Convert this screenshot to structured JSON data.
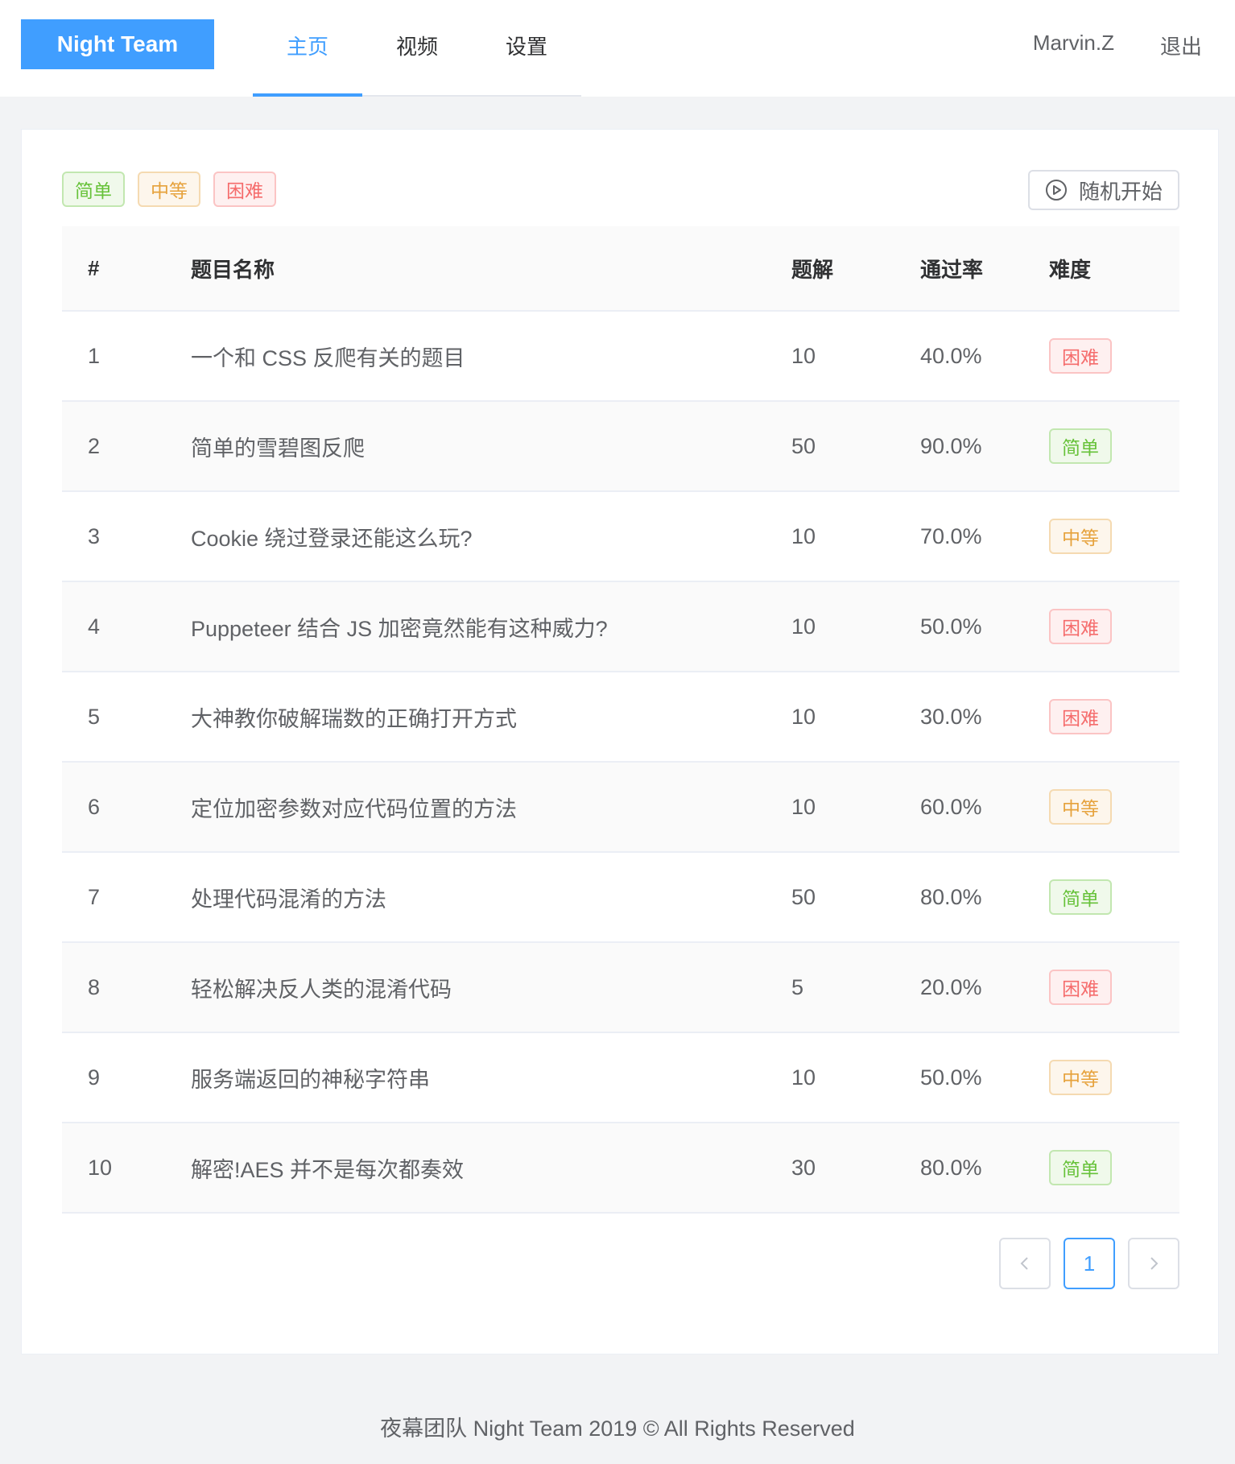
{
  "header": {
    "logo": "Night Team",
    "nav": [
      "主页",
      "视频",
      "设置"
    ],
    "user": "Marvin.Z",
    "logout": "退出"
  },
  "filters": {
    "easy": "简单",
    "medium": "中等",
    "hard": "困难",
    "random_button": "随机开始"
  },
  "table": {
    "headers": [
      "#",
      "题目名称",
      "题解",
      "通过率",
      "难度"
    ],
    "rows": [
      {
        "num": "1",
        "name": "一个和 CSS 反爬有关的题目",
        "solutions": "10",
        "rate": "40.0%",
        "difficulty": "困难",
        "level": "hard"
      },
      {
        "num": "2",
        "name": "简单的雪碧图反爬",
        "solutions": "50",
        "rate": "90.0%",
        "difficulty": "简单",
        "level": "easy"
      },
      {
        "num": "3",
        "name": "Cookie 绕过登录还能这么玩?",
        "solutions": "10",
        "rate": "70.0%",
        "difficulty": "中等",
        "level": "medium"
      },
      {
        "num": "4",
        "name": "Puppeteer 结合 JS 加密竟然能有这种威力?",
        "solutions": "10",
        "rate": "50.0%",
        "difficulty": "困难",
        "level": "hard"
      },
      {
        "num": "5",
        "name": "大神教你破解瑞数的正确打开方式",
        "solutions": "10",
        "rate": "30.0%",
        "difficulty": "困难",
        "level": "hard"
      },
      {
        "num": "6",
        "name": "定位加密参数对应代码位置的方法",
        "solutions": "10",
        "rate": "60.0%",
        "difficulty": "中等",
        "level": "medium"
      },
      {
        "num": "7",
        "name": "处理代码混淆的方法",
        "solutions": "50",
        "rate": "80.0%",
        "difficulty": "简单",
        "level": "easy"
      },
      {
        "num": "8",
        "name": "轻松解决反人类的混淆代码",
        "solutions": "5",
        "rate": "20.0%",
        "difficulty": "困难",
        "level": "hard"
      },
      {
        "num": "9",
        "name": "服务端返回的神秘字符串",
        "solutions": "10",
        "rate": "50.0%",
        "difficulty": "中等",
        "level": "medium"
      },
      {
        "num": "10",
        "name": "解密!AES 并不是每次都奏效",
        "solutions": "30",
        "rate": "80.0%",
        "difficulty": "简单",
        "level": "easy"
      }
    ]
  },
  "pagination": {
    "current": "1"
  },
  "footer": "夜幕团队 Night Team 2019 © All Rights Reserved",
  "colors": {
    "primary": "#409eff",
    "easy": "#67c23a",
    "medium": "#e6a23c",
    "hard": "#f56c6c"
  }
}
